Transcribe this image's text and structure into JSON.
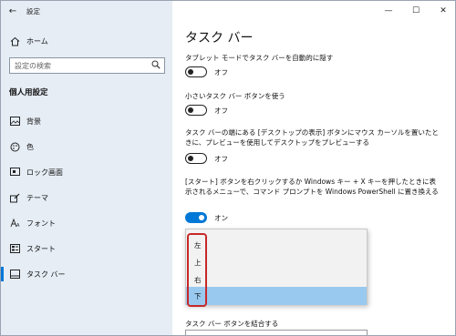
{
  "window": {
    "app_title": "設定",
    "back_icon": "←",
    "minimize_icon": "—",
    "maximize_icon": "☐",
    "close_icon": "✕"
  },
  "sidebar": {
    "home_label": "ホーム",
    "search_placeholder": "設定の検索",
    "section_heading": "個人用設定",
    "items": [
      {
        "label": "背景",
        "icon": "image-icon"
      },
      {
        "label": "色",
        "icon": "palette-icon"
      },
      {
        "label": "ロック画面",
        "icon": "lock-screen-icon"
      },
      {
        "label": "テーマ",
        "icon": "theme-brush-icon"
      },
      {
        "label": "フォント",
        "icon": "font-icon"
      },
      {
        "label": "スタート",
        "icon": "start-icon"
      },
      {
        "label": "タスク バー",
        "icon": "taskbar-icon"
      }
    ]
  },
  "main": {
    "title": "タスク バー",
    "settings": [
      {
        "desc": "タブレット モードでタスク バーを自動的に隠す",
        "state": "オフ"
      },
      {
        "desc": "小さいタスク バー ボタンを使う",
        "state": "オフ"
      },
      {
        "desc": "タスク バーの端にある [デスクトップの表示] ボタンにマウス カーソルを置いたときに、プレビューを使用してデスクトップをプレビューする",
        "state": "オフ"
      },
      {
        "desc": "[スタート] ボタンを右クリックするか Windows キー + X キーを押したときに表示されるメニューで、コマンド プロンプトを Windows PowerShell に置き換える",
        "state": "オン"
      }
    ],
    "dropdown": {
      "options": [
        "左",
        "上",
        "右",
        "下"
      ],
      "selected": "下"
    },
    "combine_label": "タスク バー ボタンを結合する"
  },
  "colors": {
    "accent": "#0078d7",
    "sidebar_bg": "#e6edf5",
    "selected_option_bg": "#99c9ef",
    "highlight_border": "#c62828"
  }
}
